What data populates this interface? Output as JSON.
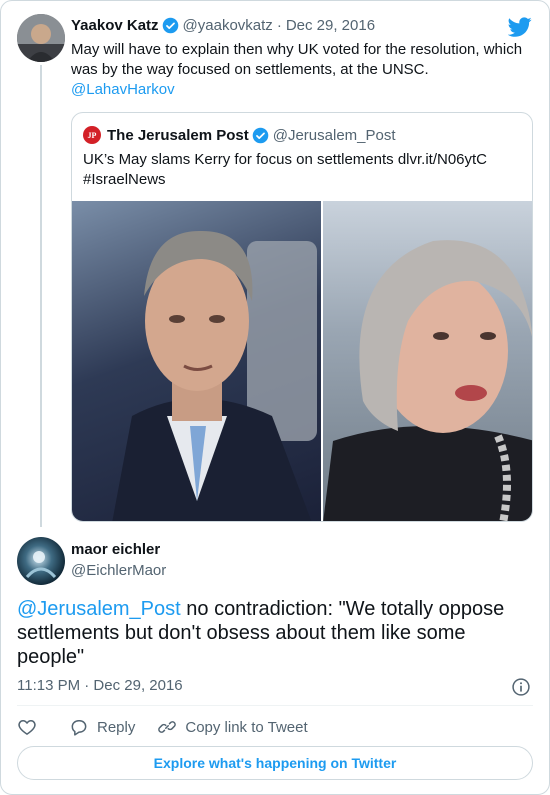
{
  "parent_tweet": {
    "author_name": "Yaakov Katz",
    "handle": "@yaakovkatz",
    "separator": "·",
    "date": "Dec 29, 2016",
    "text": "May will have to explain then why UK voted for the resolution, which was by the way focused on settlements, at the UNSC.",
    "mention": "@LahavHarkov",
    "verified": true
  },
  "quoted_tweet": {
    "author_name": "The Jerusalem Post",
    "handle": "@Jerusalem_Post",
    "logo_text": "JP",
    "text_line1": "UK’s May slams Kerry for focus on settlements dlvr.it/N06ytC",
    "text_line2": "#IsraelNews",
    "verified": true
  },
  "reply_tweet": {
    "author_name": "maor eichler",
    "handle": "@EichlerMaor",
    "mention": "@Jerusalem_Post",
    "text": " no contradiction: \"We totally oppose settlements but don't obsess about them like some people\"",
    "timestamp": "11:13 PM · Dec 29, 2016"
  },
  "actions": {
    "reply_label": "Reply",
    "copy_link_label": "Copy link to Tweet"
  },
  "explore_button_label": "Explore what's happening on Twitter",
  "colors": {
    "accent": "#1d9bf0",
    "text_primary": "#0f1419",
    "text_secondary": "#536471",
    "border": "#cfd9de",
    "jp_logo": "#d32027"
  },
  "icons": [
    "twitter-bird-icon",
    "verified-badge-icon",
    "info-icon",
    "heart-icon",
    "reply-bubble-icon",
    "link-icon"
  ]
}
